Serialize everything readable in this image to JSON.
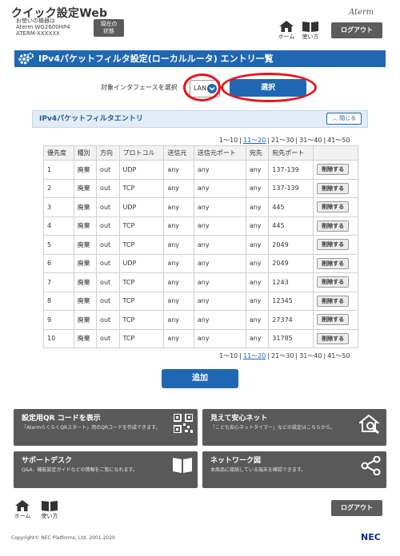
{
  "header": {
    "app_title": "クイック設定Web",
    "device_label": "お使いの機器は",
    "device_model": "Aterm WG2600HP4",
    "device_id": "ATERM-XXXXXX",
    "status_button": "現在の\n状態",
    "brand": "Aterm",
    "home_label": "ホーム",
    "guide_label": "使い方",
    "logout_label": "ログアウト"
  },
  "page_title": "IPv4パケットフィルタ設定(ローカルルータ) エントリ一覧",
  "interface": {
    "label": "対象インタフェースを選択",
    "selected": "LAN",
    "select_button": "選択"
  },
  "section": {
    "title": "IPv4パケットフィルタエントリ",
    "close_label": "閉じる"
  },
  "pager": [
    "1～10",
    "11～20",
    "21～30",
    "31～40",
    "41～50"
  ],
  "pager_current_index": 1,
  "table": {
    "headers": [
      "優先度",
      "種別",
      "方向",
      "プロトコル",
      "送信元",
      "送信元ポート",
      "宛先",
      "宛先ポート",
      ""
    ],
    "delete_label": "削除する",
    "rows": [
      [
        "1",
        "廃棄",
        "out",
        "UDP",
        "any",
        "any",
        "any",
        "137-139"
      ],
      [
        "2",
        "廃棄",
        "out",
        "TCP",
        "any",
        "any",
        "any",
        "137-139"
      ],
      [
        "3",
        "廃棄",
        "out",
        "UDP",
        "any",
        "any",
        "any",
        "445"
      ],
      [
        "4",
        "廃棄",
        "out",
        "TCP",
        "any",
        "any",
        "any",
        "445"
      ],
      [
        "5",
        "廃棄",
        "out",
        "TCP",
        "any",
        "any",
        "any",
        "2049"
      ],
      [
        "6",
        "廃棄",
        "out",
        "UDP",
        "any",
        "any",
        "any",
        "2049"
      ],
      [
        "7",
        "廃棄",
        "out",
        "TCP",
        "any",
        "any",
        "any",
        "1243"
      ],
      [
        "8",
        "廃棄",
        "out",
        "TCP",
        "any",
        "any",
        "any",
        "12345"
      ],
      [
        "9",
        "廃棄",
        "out",
        "TCP",
        "any",
        "any",
        "any",
        "27374"
      ],
      [
        "10",
        "廃棄",
        "out",
        "TCP",
        "any",
        "any",
        "any",
        "31785"
      ]
    ]
  },
  "add_button": "追加",
  "cards": [
    {
      "title": "設定用QR コードを表示",
      "desc": "「AtermらくらくQRスタート」用のQRコードを作成できます。",
      "icon": "qr-code-icon"
    },
    {
      "title": "見えて安心ネット",
      "desc": "「こども安心ネットタイマー」などの設定はこちらから。",
      "icon": "house-search-icon"
    },
    {
      "title": "サポートデスク",
      "desc": "Q&A、機能設定ガイドなどの情報をご覧になれます。",
      "icon": "book-icon"
    },
    {
      "title": "ネットワーク図",
      "desc": "本商品に接続している端末を確認できます。",
      "icon": "network-icon"
    }
  ],
  "footer": {
    "home_label": "ホーム",
    "guide_label": "使い方",
    "logout_label": "ログアウト",
    "copyright": "Copyright© NEC Platforms, Ltd. 2001-2020",
    "logo": "NEC"
  },
  "colors": {
    "accent": "#1f67b3",
    "highlight_ring": "#e8141a",
    "dark_button": "#595959"
  }
}
